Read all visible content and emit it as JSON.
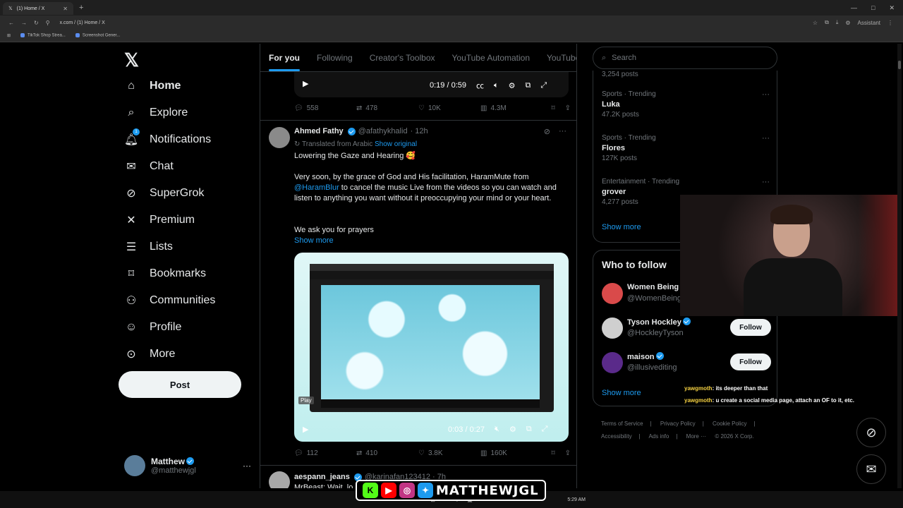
{
  "browser": {
    "tab_title": "(1) Home / X",
    "tab_icon": "x-logo-icon",
    "new_tab": "+",
    "url": "x.com / (1) Home / X",
    "assistant": "Assistant",
    "bookmarks": [
      "TikTok Shop Strea...",
      "Screenshot Gener..."
    ]
  },
  "nav": {
    "logo": "X",
    "items": [
      {
        "label": "Home",
        "icon": "home-icon",
        "glyph": "⌂"
      },
      {
        "label": "Explore",
        "icon": "search-icon",
        "glyph": "⌕"
      },
      {
        "label": "Notifications",
        "icon": "bell-icon",
        "glyph": "🔔︎"
      },
      {
        "label": "Chat",
        "icon": "mail-icon",
        "glyph": "✉"
      },
      {
        "label": "SuperGrok",
        "icon": "grok-icon",
        "glyph": "⊘"
      },
      {
        "label": "Premium",
        "icon": "x-premium-icon",
        "glyph": "✕"
      },
      {
        "label": "Lists",
        "icon": "list-icon",
        "glyph": "☰"
      },
      {
        "label": "Bookmarks",
        "icon": "bookmark-icon",
        "glyph": "⌑"
      },
      {
        "label": "Communities",
        "icon": "people-icon",
        "glyph": "⚇"
      },
      {
        "label": "Profile",
        "icon": "person-icon",
        "glyph": "☺"
      },
      {
        "label": "More",
        "icon": "more-circle-icon",
        "glyph": "⊙"
      }
    ],
    "notif_count": "1",
    "post_label": "Post",
    "account": {
      "name": "Matthew",
      "handle": "@matthewjgl",
      "more": "···"
    }
  },
  "feed": {
    "tabs": [
      "For you",
      "Following",
      "Creator's Toolbox",
      "YouTube Automation",
      "YouTube"
    ],
    "video1": {
      "time": "0:19 / 0:59"
    },
    "stats1": {
      "replies": "558",
      "reposts": "478",
      "likes": "10K",
      "views": "4.3M"
    },
    "tweet2": {
      "name": "Ahmed Fathy",
      "handle": "@afathykhalid",
      "time": "· 12h",
      "translated": "Translated from Arabic",
      "show_original": "Show original",
      "line1": "Lowering the Gaze and Hearing 🥰",
      "p1_a": "Very soon, by the grace of God and His facilitation, HaramMute from",
      "p1_link": "@HaramBlur",
      "p1_b": " to cancel the music Live from the videos so you can watch and listen to anything you want without it preoccupying your mind or your heart.",
      "p2": "We ask you for prayers",
      "show_more": "Show more",
      "play_label": "Play",
      "video_time": "0:03 / 0:27",
      "stats": {
        "replies": "112",
        "reposts": "410",
        "likes": "3.8K",
        "views": "160K"
      }
    },
    "tweet3": {
      "name": "aespann_jeans",
      "handle": "@karinafan123412 · 7h",
      "text": "MrBeast: Wait, lo"
    }
  },
  "right": {
    "search_placeholder": "Search",
    "top_count": "3,254 posts",
    "trends": [
      {
        "category": "Sports · Trending",
        "name": "Luka",
        "count": "47.2K posts"
      },
      {
        "category": "Sports · Trending",
        "name": "Flores",
        "count": "127K posts"
      },
      {
        "category": "Entertainment · Trending",
        "name": "grover",
        "count": "4,277 posts"
      }
    ],
    "show_more": "Show more",
    "who_to_follow": {
      "title": "Who to follow",
      "people": [
        {
          "name": "Women Being",
          "handle": "@WomenBeing",
          "color": "#d94a4a",
          "follow": ""
        },
        {
          "name": "Tyson Hockley",
          "handle": "@HockleyTyson",
          "color": "#cfcfcf",
          "follow": "Follow"
        },
        {
          "name": "maison",
          "handle": "@illusivediting",
          "color": "#5a2a8a",
          "follow": "Follow"
        }
      ],
      "show_more": "Show more"
    },
    "footer": [
      "Terms of Service",
      "|",
      "Privacy Policy",
      "|",
      "Cookie Policy",
      "|",
      "Accessibility",
      "|",
      "Ads info",
      "|",
      "More ···",
      "© 2026 X Corp."
    ]
  },
  "chat": [
    {
      "user": "yawgmoth",
      "msg": ": its deeper than that"
    },
    {
      "user": "yawgmoth",
      "msg": ": u create a social media page, attach an OF to it, etc."
    }
  ],
  "banner": {
    "text": "MATTHEWJGL"
  },
  "taskbar": {
    "clock": "5:29 AM"
  },
  "colors": {
    "accent": "#1d9bf0",
    "bg": "#000000",
    "muted": "#71767b"
  }
}
